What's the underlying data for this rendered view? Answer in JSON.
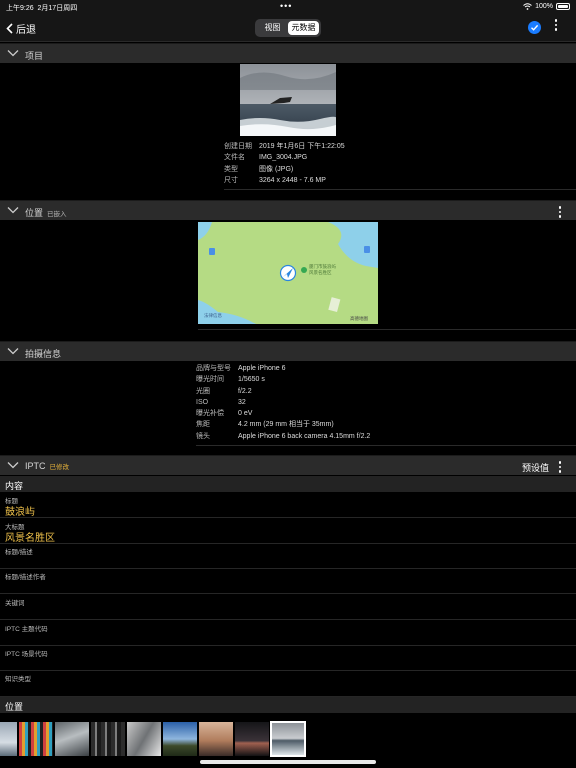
{
  "status_bar": {
    "time": "上午9:26",
    "date": "2月17日周四",
    "battery": "100%"
  },
  "nav": {
    "back_label": "后退",
    "tabs": [
      "视图",
      "元数据"
    ],
    "selected_tab": "元数据"
  },
  "sections": {
    "item": {
      "title": "项目",
      "fields": [
        {
          "label": "创建日期",
          "value": "2019 年1月6日 下午1:22:05"
        },
        {
          "label": "文件名",
          "value": "IMG_3004.JPG"
        },
        {
          "label": "类型",
          "value": "图像 (JPG)"
        },
        {
          "label": "尺寸",
          "value": "3264 x 2448 - 7.6 MP"
        }
      ]
    },
    "location": {
      "title": "位置",
      "subtitle": "已嵌入",
      "map": {
        "poi_label_1": "厦门市鼓浪屿",
        "poi_label_2": "风景名胜区",
        "corner_left": "法律信息",
        "corner_right": "高德地图"
      }
    },
    "shooting": {
      "title": "拍摄信息",
      "fields": [
        {
          "label": "品牌与型号",
          "value": "Apple iPhone 6"
        },
        {
          "label": "曝光时间",
          "value": "1/5650 s"
        },
        {
          "label": "光圈",
          "value": "f/2.2"
        },
        {
          "label": "ISO",
          "value": "32"
        },
        {
          "label": "曝光补偿",
          "value": "0 eV"
        },
        {
          "label": "焦距",
          "value": "4.2 mm (29 mm 相当于 35mm)"
        },
        {
          "label": "镜头",
          "value": "Apple iPhone 6 back camera 4.15mm f/2.2"
        }
      ]
    },
    "iptc": {
      "title": "IPTC",
      "subtitle": "已修改",
      "preset_label": "预设值",
      "content_group": "内容",
      "location_group": "位置",
      "rows": [
        {
          "label": "标题",
          "value": "鼓浪屿"
        },
        {
          "label": "大标题",
          "value": "风景名胜区"
        },
        {
          "label": "标题/描述",
          "value": ""
        },
        {
          "label": "标题/描述作者",
          "value": ""
        },
        {
          "label": "关键词",
          "value": ""
        },
        {
          "label": "IPTC 主题代码",
          "value": ""
        },
        {
          "label": "IPTC 场景代码",
          "value": ""
        },
        {
          "label": "知识类型",
          "value": ""
        }
      ]
    }
  },
  "colors": {
    "accent": "#1a7cff",
    "modified": "#e6b23a",
    "value_yellow": "#f0c24b",
    "map_land": "#b5db84",
    "map_water": "#8ed0ea"
  }
}
